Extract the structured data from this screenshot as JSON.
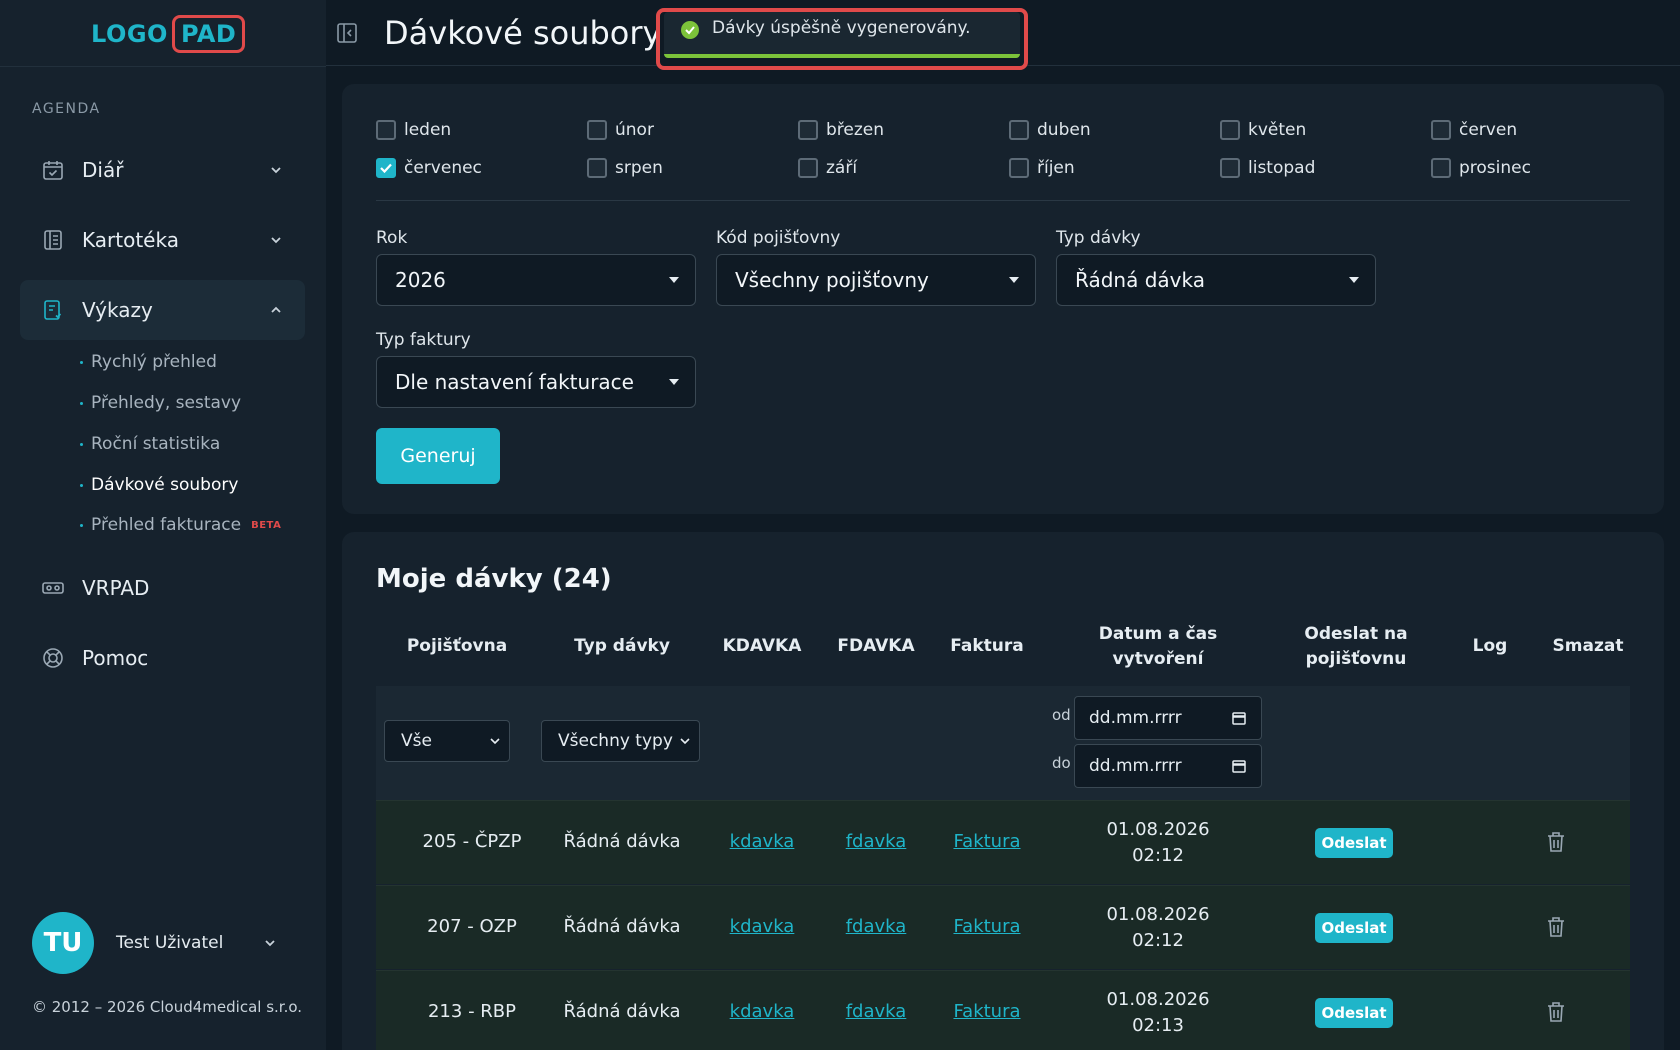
{
  "brand": {
    "logo_left": "LOGO",
    "logo_right": "PAD"
  },
  "sidebar": {
    "section_label": "AGENDA",
    "items": [
      {
        "label": "Diář",
        "icon": "calendar-icon"
      },
      {
        "label": "Kartotéka",
        "icon": "book-icon"
      },
      {
        "label": "Výkazy",
        "icon": "report-icon"
      },
      {
        "label": "VRPAD",
        "icon": "vr-icon"
      },
      {
        "label": "Pomoc",
        "icon": "lifebuoy-icon"
      }
    ],
    "sub_items": [
      {
        "label": "Rychlý přehled"
      },
      {
        "label": "Přehledy, sestavy"
      },
      {
        "label": "Roční statistika"
      },
      {
        "label": "Dávkové soubory"
      },
      {
        "label": "Přehled fakturace",
        "badge": "BETA"
      }
    ],
    "user": {
      "initials": "TU",
      "name": "Test Uživatel"
    },
    "copyright": "© 2012 – 2026 Cloud4medical s.r.o."
  },
  "header": {
    "title": "Dávkové soubory"
  },
  "toast": {
    "message": "Dávky úspěšně vygenerovány."
  },
  "filters": {
    "months": [
      {
        "label": "leden",
        "checked": false
      },
      {
        "label": "únor",
        "checked": false
      },
      {
        "label": "březen",
        "checked": false
      },
      {
        "label": "duben",
        "checked": false
      },
      {
        "label": "květen",
        "checked": false
      },
      {
        "label": "červen",
        "checked": false
      },
      {
        "label": "červenec",
        "checked": true
      },
      {
        "label": "srpen",
        "checked": false
      },
      {
        "label": "září",
        "checked": false
      },
      {
        "label": "říjen",
        "checked": false
      },
      {
        "label": "listopad",
        "checked": false
      },
      {
        "label": "prosinec",
        "checked": false
      }
    ],
    "year": {
      "label": "Rok",
      "value": "2026"
    },
    "insurer": {
      "label": "Kód pojišťovny",
      "value": "Všechny pojišťovny"
    },
    "batch_type": {
      "label": "Typ dávky",
      "value": "Řádná dávka"
    },
    "invoice_type": {
      "label": "Typ faktury",
      "value": "Dle nastavení fakturace"
    },
    "generate_label": "Generuj"
  },
  "batches": {
    "title": "Moje dávky (24)",
    "columns": {
      "insurer": "Pojišťovna",
      "type": "Typ dávky",
      "kdavka": "KDAVKA",
      "fdavka": "FDAVKA",
      "invoice": "Faktura",
      "created_1": "Datum a čas",
      "created_2": "vytvoření",
      "send_1": "Odeslat na",
      "send_2": "pojišťovnu",
      "log": "Log",
      "delete": "Smazat"
    },
    "filter": {
      "insurer": "Vše",
      "type": "Všechny typy",
      "from_label": "od",
      "to_label": "do",
      "date_placeholder": "dd.mm.rrrr"
    },
    "rows": [
      {
        "insurer": "205 - ČPZP",
        "type": "Řádná dávka",
        "kdavka": "kdavka",
        "fdavka": "fdavka",
        "invoice": "Faktura",
        "date": "01.08.2026",
        "time": "02:12",
        "send": "Odeslat"
      },
      {
        "insurer": "207 - OZP",
        "type": "Řádná dávka",
        "kdavka": "kdavka",
        "fdavka": "fdavka",
        "invoice": "Faktura",
        "date": "01.08.2026",
        "time": "02:12",
        "send": "Odeslat"
      },
      {
        "insurer": "213 - RBP",
        "type": "Řádná dávka",
        "kdavka": "kdavka",
        "fdavka": "fdavka",
        "invoice": "Faktura",
        "date": "01.08.2026",
        "time": "02:13",
        "send": "Odeslat"
      }
    ]
  },
  "colors": {
    "accent": "#1fb5c9",
    "danger": "#e04a4a",
    "success": "#7cc33a"
  }
}
